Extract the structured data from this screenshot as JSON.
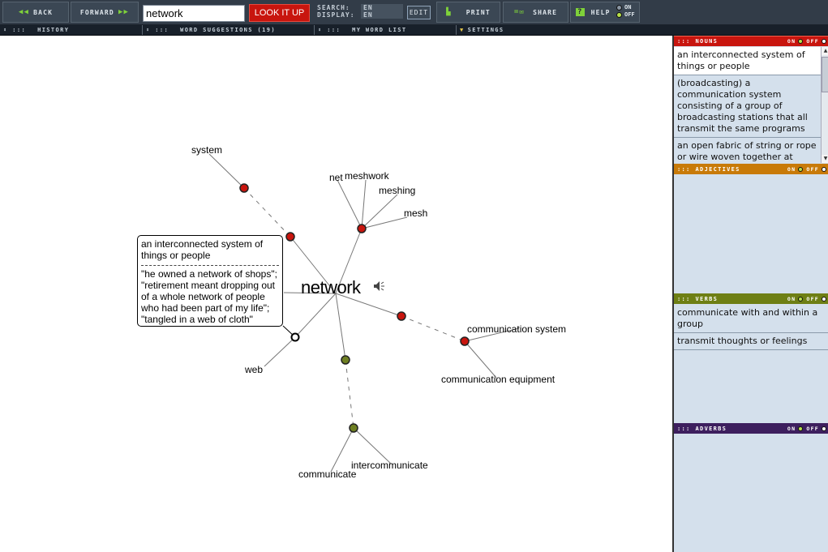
{
  "toolbar": {
    "back_label": "BACK",
    "forward_label": "FORWARD",
    "search_value": "network",
    "lookup_label": "LOOK IT UP",
    "search_lang_label": "SEARCH:",
    "search_lang_value": "EN",
    "display_lang_label": "DISPLAY:",
    "display_lang_value": "EN",
    "edit_label": "EDIT",
    "print_label": "PRINT",
    "share_label": "SHARE",
    "help_label": "HELP",
    "help_on_label": "ON",
    "help_off_label": "OFF",
    "help_state": "off"
  },
  "subbar": {
    "history_label": "HISTORY",
    "suggestions_label": "WORD SUGGESTIONS (19)",
    "wordlist_label": "MY WORD LIST",
    "settings_label": "SETTINGS"
  },
  "graph": {
    "center_word": "network",
    "speaker_icon": "speaker-icon",
    "colors": {
      "noun": "#c8150e",
      "verb": "#6e7f22",
      "selected": "#ffffff"
    },
    "words": {
      "system": "system",
      "net": "net",
      "meshwork": "meshwork",
      "meshing": "meshing",
      "mesh": "mesh",
      "web": "web",
      "communication_system": "communication system",
      "communication_equipment": "communication equipment",
      "communicate": "communicate",
      "intercommunicate": "intercommunicate"
    },
    "tooltip": {
      "definition": "an interconnected system of things or people",
      "examples": "\"he owned a network of shops\"; \"retirement meant dropping out of a whole network of people who had been part of my life\"; \"tangled in a web of cloth\""
    }
  },
  "panels": {
    "nouns": {
      "title": "NOUNS",
      "on": "ON",
      "off": "OFF",
      "color": "#c8150e",
      "items": [
        "an interconnected system of things or people",
        "(broadcasting) a communication system consisting of a group of broadcasting stations that all transmit the same programs",
        "an open fabric of string or rope or wire woven together at"
      ]
    },
    "adjectives": {
      "title": "ADJECTIVES",
      "on": "ON",
      "off": "OFF",
      "color": "#c87a08",
      "items": []
    },
    "verbs": {
      "title": "VERBS",
      "on": "ON",
      "off": "OFF",
      "color": "#6e7f14",
      "items": [
        "communicate with and within a group",
        "transmit thoughts or feelings"
      ]
    },
    "adverbs": {
      "title": "ADVERBS",
      "on": "ON",
      "off": "OFF",
      "color": "#3d1f5e",
      "items": []
    }
  }
}
